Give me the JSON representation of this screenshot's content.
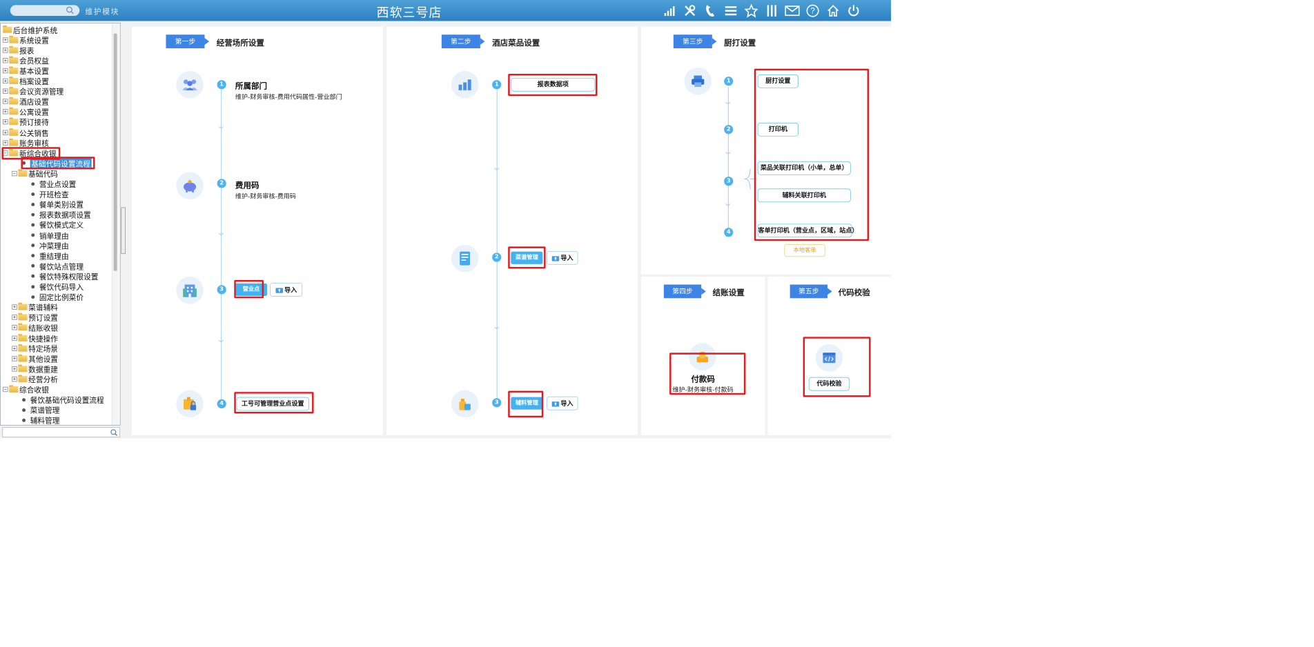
{
  "header": {
    "module_label": "维护模块",
    "store_title": "西软三号店",
    "icons": [
      "signal-icon",
      "tools-icon",
      "phone-icon",
      "menu-icon",
      "star-icon",
      "columns-icon",
      "mail-icon",
      "help-icon",
      "home-icon",
      "power-icon"
    ]
  },
  "tree": {
    "root": "后台维护系统",
    "top_items": [
      "系统设置",
      "报表",
      "会员权益",
      "基本设置",
      "档案设置",
      "会议资源管理",
      "酒店设置",
      "公寓设置",
      "预订接待",
      "公关销售",
      "账务审核"
    ],
    "expanded": "新综合收银",
    "selected": "基础代码设置流程",
    "basic_code": "基础代码",
    "basic_code_children": [
      "营业点设置",
      "开班检查",
      "餐单类别设置",
      "报表数据项设置",
      "餐饮模式定义",
      "销单理由",
      "冲菜理由",
      "重结理由",
      "餐饮站点管理",
      "餐饮特殊权限设置",
      "餐饮代码导入",
      "固定比例菜价"
    ],
    "sub_folders": [
      "菜谱辅料",
      "预订设置",
      "结账收银",
      "快捷操作",
      "特定场景",
      "其他设置",
      "数据重建",
      "经营分析"
    ],
    "second_root": "综合收银",
    "second_children": [
      "餐饮基础代码设置流程",
      "菜谱管理",
      "辅料管理"
    ]
  },
  "step1": {
    "tag": "第一步",
    "title": "经营场所设置",
    "items": [
      {
        "num": "1",
        "title": "所属部门",
        "desc": "维护-财务审核-费用代码属性-营业部门"
      },
      {
        "num": "2",
        "title": "费用码",
        "desc": "维护-财务审核-费用码"
      },
      {
        "num": "3",
        "button": "营业点",
        "import": "导入"
      },
      {
        "num": "4",
        "button": "工号可管理营业点设置"
      }
    ]
  },
  "step2": {
    "tag": "第二步",
    "title": "酒店菜品设置",
    "items": [
      {
        "num": "1",
        "button": "报表数据项"
      },
      {
        "num": "2",
        "button": "菜谱管理",
        "import": "导入"
      },
      {
        "num": "3",
        "button": "辅料管理",
        "import": "导入"
      }
    ]
  },
  "step3": {
    "tag": "第三步",
    "title": "厨打设置",
    "nums": [
      "1",
      "2",
      "3",
      "4"
    ],
    "buttons": [
      "厨打设置",
      "打印机",
      "菜品关联打印机（小单，总单）",
      "辅料关联打印机",
      "客单打印机（营业点，区域，站点）"
    ],
    "ghost": "本地客单"
  },
  "step4": {
    "tag": "第四步",
    "title": "结账设置",
    "item_title": "付款码",
    "item_desc": "维护-财务审核-付款码"
  },
  "step5": {
    "tag": "第五步",
    "title": "代码校验",
    "button": "代码校验"
  }
}
